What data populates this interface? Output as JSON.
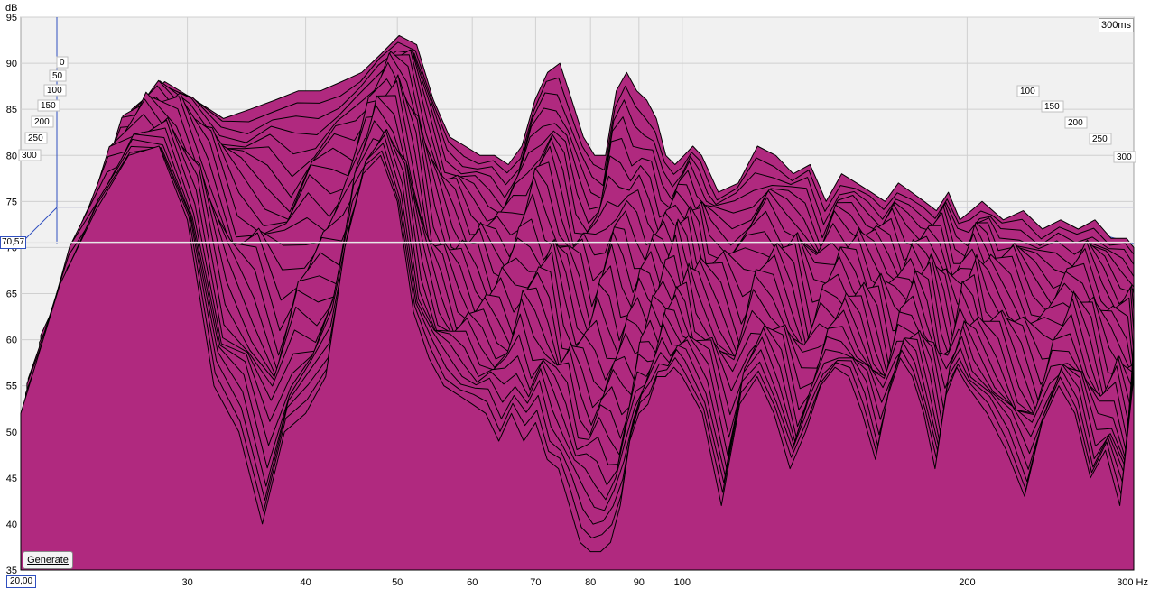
{
  "chart_data": {
    "type": "area",
    "kind": "waterfall",
    "y_unit": "dB",
    "x_unit": "Hz",
    "x_scale": "log",
    "xlim": [
      20,
      300
    ],
    "ylim": [
      35,
      95
    ],
    "x_ticks": [
      "30",
      "40",
      "50",
      "60",
      "70",
      "80",
      "90",
      "100",
      "200"
    ],
    "x_end_label": "300 Hz",
    "y_ticks": [
      "95",
      "90",
      "85",
      "80",
      "75",
      "70",
      "65",
      "60",
      "55",
      "50",
      "45",
      "40",
      "35"
    ],
    "time_ticks_left": [
      "0",
      "50",
      "100",
      "150",
      "200",
      "250",
      "300"
    ],
    "time_ticks_right": [
      "100",
      "150",
      "200",
      "250",
      "300"
    ],
    "time_window": "300ms",
    "cursor_value": "70,57",
    "x_origin_label": "20,00",
    "fill_color": "#b0297f",
    "line_color": "#000000",
    "slice_count": 30,
    "front_slice": {
      "freq": [
        20,
        22,
        24,
        26,
        28,
        30,
        32,
        34,
        36,
        38,
        40,
        42,
        44,
        46,
        48,
        50,
        52,
        54,
        56,
        58,
        60,
        62,
        64,
        66,
        68,
        70,
        72,
        74,
        76,
        78,
        80,
        82,
        84,
        86,
        88,
        90,
        92,
        94,
        96,
        98,
        100,
        105,
        110,
        115,
        120,
        125,
        130,
        135,
        140,
        145,
        150,
        155,
        160,
        165,
        170,
        175,
        180,
        185,
        190,
        195,
        200,
        210,
        220,
        230,
        240,
        250,
        260,
        270,
        280,
        290,
        300
      ],
      "db": [
        52,
        66,
        74,
        80,
        81,
        73,
        55,
        50,
        40,
        50,
        52,
        56,
        70,
        78,
        80,
        75,
        63,
        58,
        55,
        54,
        53,
        52,
        49,
        52,
        49,
        51,
        47,
        46,
        42,
        38,
        37,
        37,
        38,
        42,
        49,
        52,
        53,
        56,
        56,
        57,
        56,
        52,
        42,
        53,
        56,
        52,
        46,
        50,
        55,
        57,
        56,
        52,
        47,
        54,
        58,
        56,
        52,
        46,
        54,
        57,
        55,
        52,
        48,
        43,
        51,
        55,
        52,
        45,
        48,
        42,
        56
      ]
    },
    "rear_slice": {
      "freq": [
        20,
        22,
        24,
        26,
        28,
        30,
        32,
        34,
        36,
        38,
        40,
        42,
        44,
        46,
        48,
        50,
        52,
        54,
        56,
        58,
        60,
        62,
        64,
        66,
        68,
        70,
        72,
        74,
        76,
        78,
        80,
        82,
        84,
        86,
        88,
        90,
        92,
        94,
        96,
        98,
        100,
        105,
        110,
        115,
        120,
        125,
        130,
        135,
        140,
        145,
        150,
        155,
        160,
        165,
        170,
        175,
        180,
        185,
        190,
        195,
        200,
        210,
        220,
        230,
        240,
        250,
        260,
        270,
        280,
        290,
        300
      ],
      "db": [
        62,
        73,
        85,
        88,
        86,
        84,
        85,
        86,
        87,
        87,
        88,
        89,
        91,
        93,
        92,
        86,
        82,
        81,
        80,
        80,
        79,
        81,
        86,
        89,
        90,
        86,
        82,
        80,
        80,
        87,
        89,
        87,
        86,
        84,
        80,
        79,
        80,
        81,
        80,
        78,
        76,
        77,
        81,
        80,
        78,
        79,
        75,
        78,
        77,
        76,
        75,
        77,
        76,
        75,
        74,
        76,
        73,
        74,
        75,
        74,
        73,
        74,
        72,
        73,
        72,
        73,
        71,
        71,
        70,
        70,
        70
      ]
    }
  },
  "controls": {
    "generate_label": "Generate"
  }
}
